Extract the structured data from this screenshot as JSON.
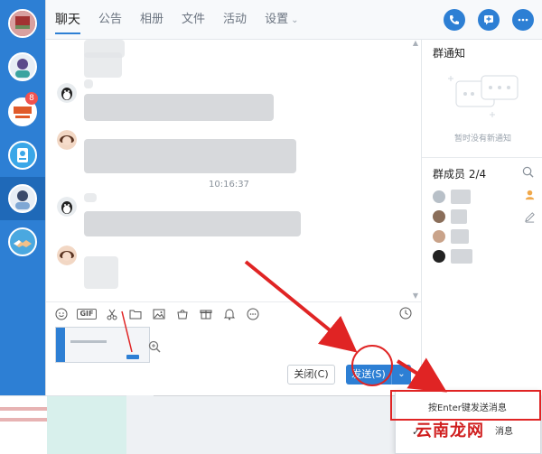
{
  "nav": {
    "badge_count": "8"
  },
  "header": {
    "tabs": [
      {
        "label": "聊天"
      },
      {
        "label": "公告"
      },
      {
        "label": "相册"
      },
      {
        "label": "文件"
      },
      {
        "label": "活动"
      },
      {
        "label": "设置"
      }
    ],
    "settings_caret": "⌄"
  },
  "chat": {
    "timestamp": "10:16:37"
  },
  "toolbar": {
    "gif_label": "GIF"
  },
  "input": {
    "close_button": "关闭(C)",
    "send_button": "发送(S)",
    "send_dropdown": "⌄"
  },
  "right_panel": {
    "notice_title": "群通知",
    "notice_empty": "暂时没有新通知",
    "members_title": "群成员 2/4"
  },
  "popup": {
    "items": [
      {
        "label": "按Enter键发送消息"
      },
      {
        "label": "消息"
      }
    ]
  },
  "watermark": "云南龙网",
  "colors": {
    "primary": "#2d7fd4",
    "badge": "#f0524f",
    "annotation": "#e02424"
  }
}
